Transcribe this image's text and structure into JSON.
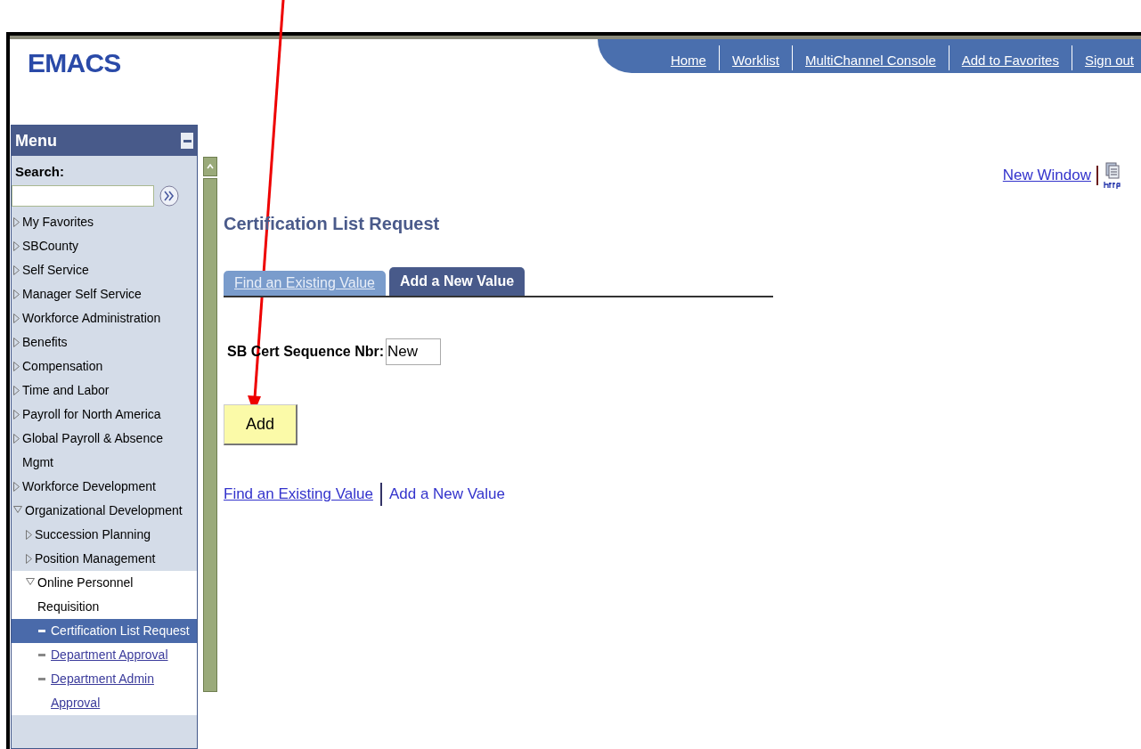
{
  "logo": "EMACS",
  "nav_links": [
    "Home",
    "Worklist",
    "MultiChannel Console",
    "Add to Favorites",
    "Sign out"
  ],
  "menu": {
    "title": "Menu",
    "search_label": "Search:",
    "items": [
      {
        "label": "My Favorites",
        "expanded": false
      },
      {
        "label": "SBCounty",
        "expanded": false
      },
      {
        "label": "Self Service",
        "expanded": false
      },
      {
        "label": "Manager Self Service",
        "expanded": false
      },
      {
        "label": "Workforce Administration",
        "expanded": false
      },
      {
        "label": "Benefits",
        "expanded": false
      },
      {
        "label": "Compensation",
        "expanded": false
      },
      {
        "label": "Time and Labor",
        "expanded": false
      },
      {
        "label": "Payroll for North America",
        "expanded": false
      },
      {
        "label": "Global Payroll & Absence Mgmt",
        "expanded": false
      },
      {
        "label": "Workforce Development",
        "expanded": false
      },
      {
        "label": "Organizational Development",
        "expanded": true,
        "children": [
          {
            "label": "Succession Planning",
            "expanded": false
          },
          {
            "label": "Position Management",
            "expanded": false
          },
          {
            "label": "Online Personnel Requisition",
            "expanded": true,
            "children": [
              {
                "label": "Certification List Request",
                "kind": "page",
                "selected": true
              },
              {
                "label": "Department Approval",
                "kind": "page",
                "selected": false
              },
              {
                "label": "Department Admin Approval",
                "kind": "page",
                "selected": false
              }
            ]
          }
        ]
      }
    ]
  },
  "new_window_link": "New Window",
  "page_title": "Certification List Request",
  "tabs": [
    {
      "label": "Find an Existing Value",
      "selected": false
    },
    {
      "label": "Add a New Value",
      "selected": true
    }
  ],
  "field": {
    "label": "SB Cert Sequence Nbr:",
    "value": "New"
  },
  "add_button": "Add",
  "bottom_links": [
    {
      "label": "Find an Existing Value",
      "selected": false
    },
    {
      "label": "Add a New Value",
      "selected": true
    }
  ]
}
